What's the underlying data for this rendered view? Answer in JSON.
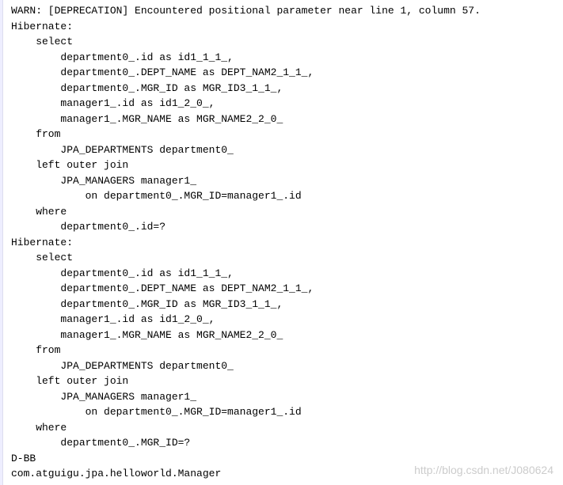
{
  "lines": [
    {
      "text": "WARN: [DEPRECATION] Encountered positional parameter near line 1, column 57.",
      "type": "warn"
    },
    {
      "text": "Hibernate: ",
      "type": "normal"
    },
    {
      "text": "    select",
      "type": "normal"
    },
    {
      "text": "        department0_.id as id1_1_1_,",
      "type": "normal"
    },
    {
      "text": "        department0_.DEPT_NAME as DEPT_NAM2_1_1_,",
      "type": "normal"
    },
    {
      "text": "        department0_.MGR_ID as MGR_ID3_1_1_,",
      "type": "normal"
    },
    {
      "text": "        manager1_.id as id1_2_0_,",
      "type": "normal"
    },
    {
      "text": "        manager1_.MGR_NAME as MGR_NAME2_2_0_ ",
      "type": "normal"
    },
    {
      "text": "    from",
      "type": "normal"
    },
    {
      "text": "        JPA_DEPARTMENTS department0_ ",
      "type": "normal"
    },
    {
      "text": "    left outer join",
      "type": "normal"
    },
    {
      "text": "        JPA_MANAGERS manager1_ ",
      "type": "normal"
    },
    {
      "text": "            on department0_.MGR_ID=manager1_.id ",
      "type": "normal"
    },
    {
      "text": "    where",
      "type": "normal"
    },
    {
      "text": "        department0_.id=?",
      "type": "normal"
    },
    {
      "text": "Hibernate: ",
      "type": "normal"
    },
    {
      "text": "    select",
      "type": "normal"
    },
    {
      "text": "        department0_.id as id1_1_1_,",
      "type": "normal"
    },
    {
      "text": "        department0_.DEPT_NAME as DEPT_NAM2_1_1_,",
      "type": "normal"
    },
    {
      "text": "        department0_.MGR_ID as MGR_ID3_1_1_,",
      "type": "normal"
    },
    {
      "text": "        manager1_.id as id1_2_0_,",
      "type": "normal"
    },
    {
      "text": "        manager1_.MGR_NAME as MGR_NAME2_2_0_ ",
      "type": "normal"
    },
    {
      "text": "    from",
      "type": "normal"
    },
    {
      "text": "        JPA_DEPARTMENTS department0_ ",
      "type": "normal"
    },
    {
      "text": "    left outer join",
      "type": "normal"
    },
    {
      "text": "        JPA_MANAGERS manager1_ ",
      "type": "normal"
    },
    {
      "text": "            on department0_.MGR_ID=manager1_.id ",
      "type": "normal"
    },
    {
      "text": "    where",
      "type": "normal"
    },
    {
      "text": "        department0_.MGR_ID=?",
      "type": "normal"
    },
    {
      "text": "D-BB",
      "type": "normal"
    },
    {
      "text": "com.atguigu.jpa.helloworld.Manager",
      "type": "normal"
    }
  ],
  "watermark": "http://blog.csdn.net/J080624"
}
